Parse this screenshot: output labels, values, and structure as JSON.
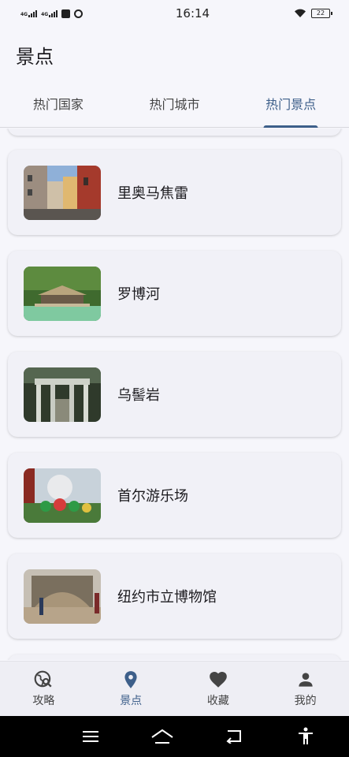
{
  "status_bar": {
    "net1": "4G",
    "net2": "4G",
    "time": "16:14",
    "battery": "22"
  },
  "header": {
    "title": "景点"
  },
  "tabs": [
    {
      "label": "热门国家",
      "active": false
    },
    {
      "label": "热门城市",
      "active": false
    },
    {
      "label": "热门景点",
      "active": true
    }
  ],
  "attractions": [
    {
      "name": "里奥马焦雷",
      "thumb_icon": "street-photo"
    },
    {
      "name": "罗博河",
      "thumb_icon": "pavilion-photo"
    },
    {
      "name": "乌髻岩",
      "thumb_icon": "gate-photo"
    },
    {
      "name": "首尔游乐场",
      "thumb_icon": "amusement-photo"
    },
    {
      "name": "纽约市立博物馆",
      "thumb_icon": "museum-photo"
    }
  ],
  "bottom_nav": [
    {
      "label": "攻略",
      "icon": "travel-explore-icon",
      "active": false
    },
    {
      "label": "景点",
      "icon": "location-pin-icon",
      "active": true
    },
    {
      "label": "收藏",
      "icon": "heart-icon",
      "active": false
    },
    {
      "label": "我的",
      "icon": "person-icon",
      "active": false
    }
  ],
  "colors": {
    "accent": "#3d5f8a",
    "background": "#f6f6fb",
    "card": "#f1f1f7"
  }
}
